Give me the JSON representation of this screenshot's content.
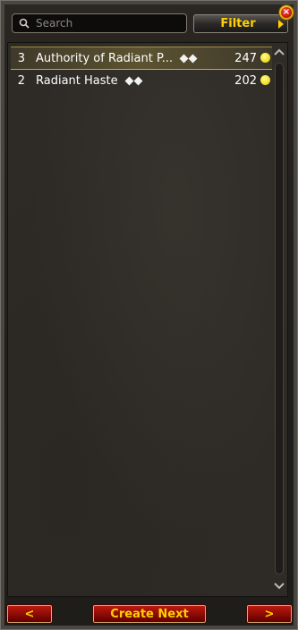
{
  "search": {
    "placeholder": "Search",
    "value": ""
  },
  "filter_button": {
    "label": "Filter"
  },
  "close_button": {
    "label": "×"
  },
  "list": {
    "items": [
      {
        "rank": "3",
        "name": "Authority of Radiant P...",
        "count": "247",
        "selected": true
      },
      {
        "rank": "2",
        "name": "Radiant Haste",
        "count": "202",
        "selected": false
      }
    ]
  },
  "footer": {
    "prev_label": "<",
    "create_next_label": "Create Next",
    "next_label": ">"
  },
  "colors": {
    "accent_gold": "#ffd100",
    "button_red": "#c21c10",
    "coin": "#e6c800"
  },
  "icons": {
    "search": "search-icon",
    "close": "close-icon",
    "quality": "diamond-icon",
    "currency": "gold-coin-icon"
  }
}
